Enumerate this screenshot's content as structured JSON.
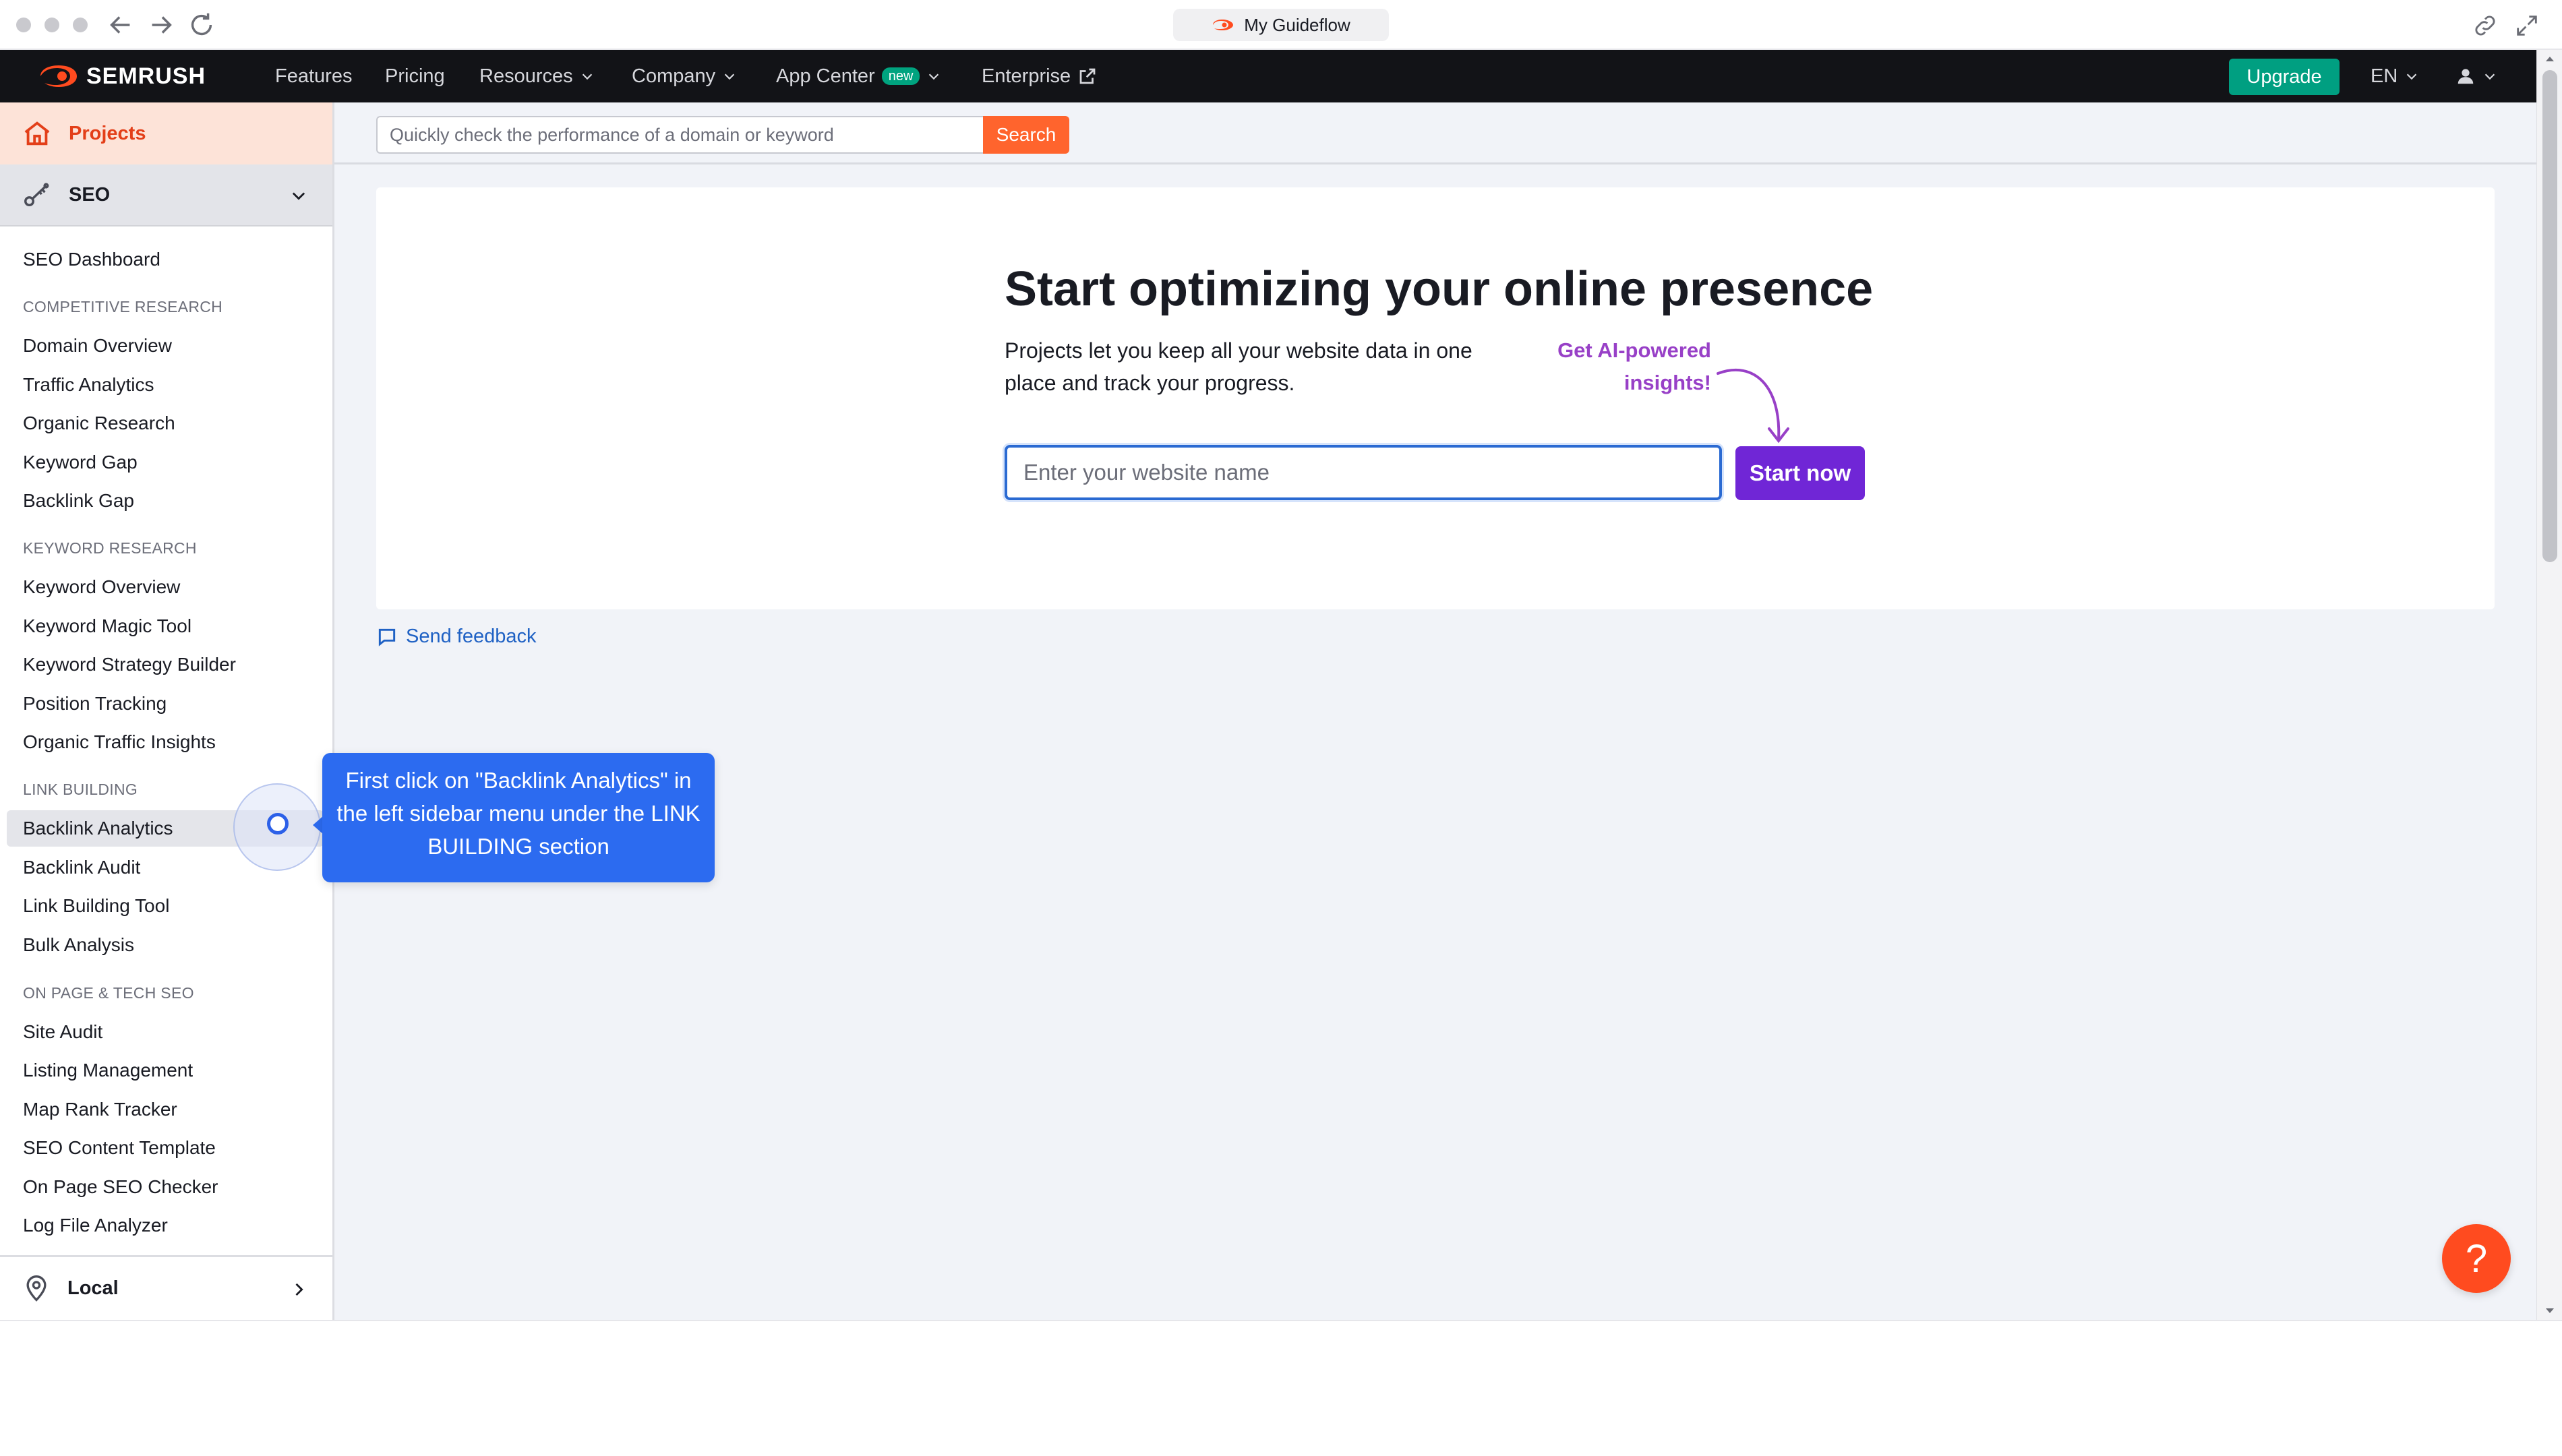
{
  "browser": {
    "tab_title": "My Guideflow"
  },
  "topnav": {
    "logo_text": "SEMRUSH",
    "items": [
      {
        "label": "Features"
      },
      {
        "label": "Pricing"
      },
      {
        "label": "Resources"
      },
      {
        "label": "Company"
      },
      {
        "label": "App Center",
        "badge": "new"
      },
      {
        "label": "Enterprise"
      }
    ],
    "upgrade_label": "Upgrade",
    "language": "EN"
  },
  "sidebar": {
    "projects_label": "Projects",
    "seo_label": "SEO",
    "dashboard_label": "SEO Dashboard",
    "sections": [
      {
        "title": "COMPETITIVE RESEARCH",
        "items": [
          "Domain Overview",
          "Traffic Analytics",
          "Organic Research",
          "Keyword Gap",
          "Backlink Gap"
        ]
      },
      {
        "title": "KEYWORD RESEARCH",
        "items": [
          "Keyword Overview",
          "Keyword Magic Tool",
          "Keyword Strategy Builder",
          "Position Tracking",
          "Organic Traffic Insights"
        ]
      },
      {
        "title": "LINK BUILDING",
        "items": [
          "Backlink Analytics",
          "Backlink Audit",
          "Link Building Tool",
          "Bulk Analysis"
        ]
      },
      {
        "title": "ON PAGE & TECH SEO",
        "items": [
          "Site Audit",
          "Listing Management",
          "Map Rank Tracker",
          "SEO Content Template",
          "On Page SEO Checker",
          "Log File Analyzer"
        ]
      }
    ],
    "local_label": "Local"
  },
  "search": {
    "placeholder": "Quickly check the performance of a domain or keyword",
    "value": "",
    "button_label": "Search"
  },
  "hero": {
    "title": "Start optimizing your online presence",
    "description": "Projects let you keep all your website data in one place and track your progress.",
    "ai_note": "Get AI-powered insights!",
    "input_placeholder": "Enter your website name",
    "input_value": "",
    "button_label": "Start now"
  },
  "feedback_label": "Send feedback",
  "tooltip": {
    "text": "First click on \"Backlink Analytics\" in the left sidebar menu under the LINK BUILDING section"
  },
  "help_label": "?",
  "colors": {
    "brand_orange": "#ff642d",
    "upgrade_green": "#009f81",
    "start_purple": "#7026d6",
    "ai_purple": "#9840c7",
    "tooltip_blue": "#2c6bf0",
    "link_blue": "#1f61c4"
  },
  "icons": {
    "projects": "home-icon",
    "seo": "seo-key-icon",
    "local": "location-pin-icon",
    "feedback": "chat-bubble-icon",
    "enterprise": "external-link-icon",
    "account": "user-icon"
  }
}
